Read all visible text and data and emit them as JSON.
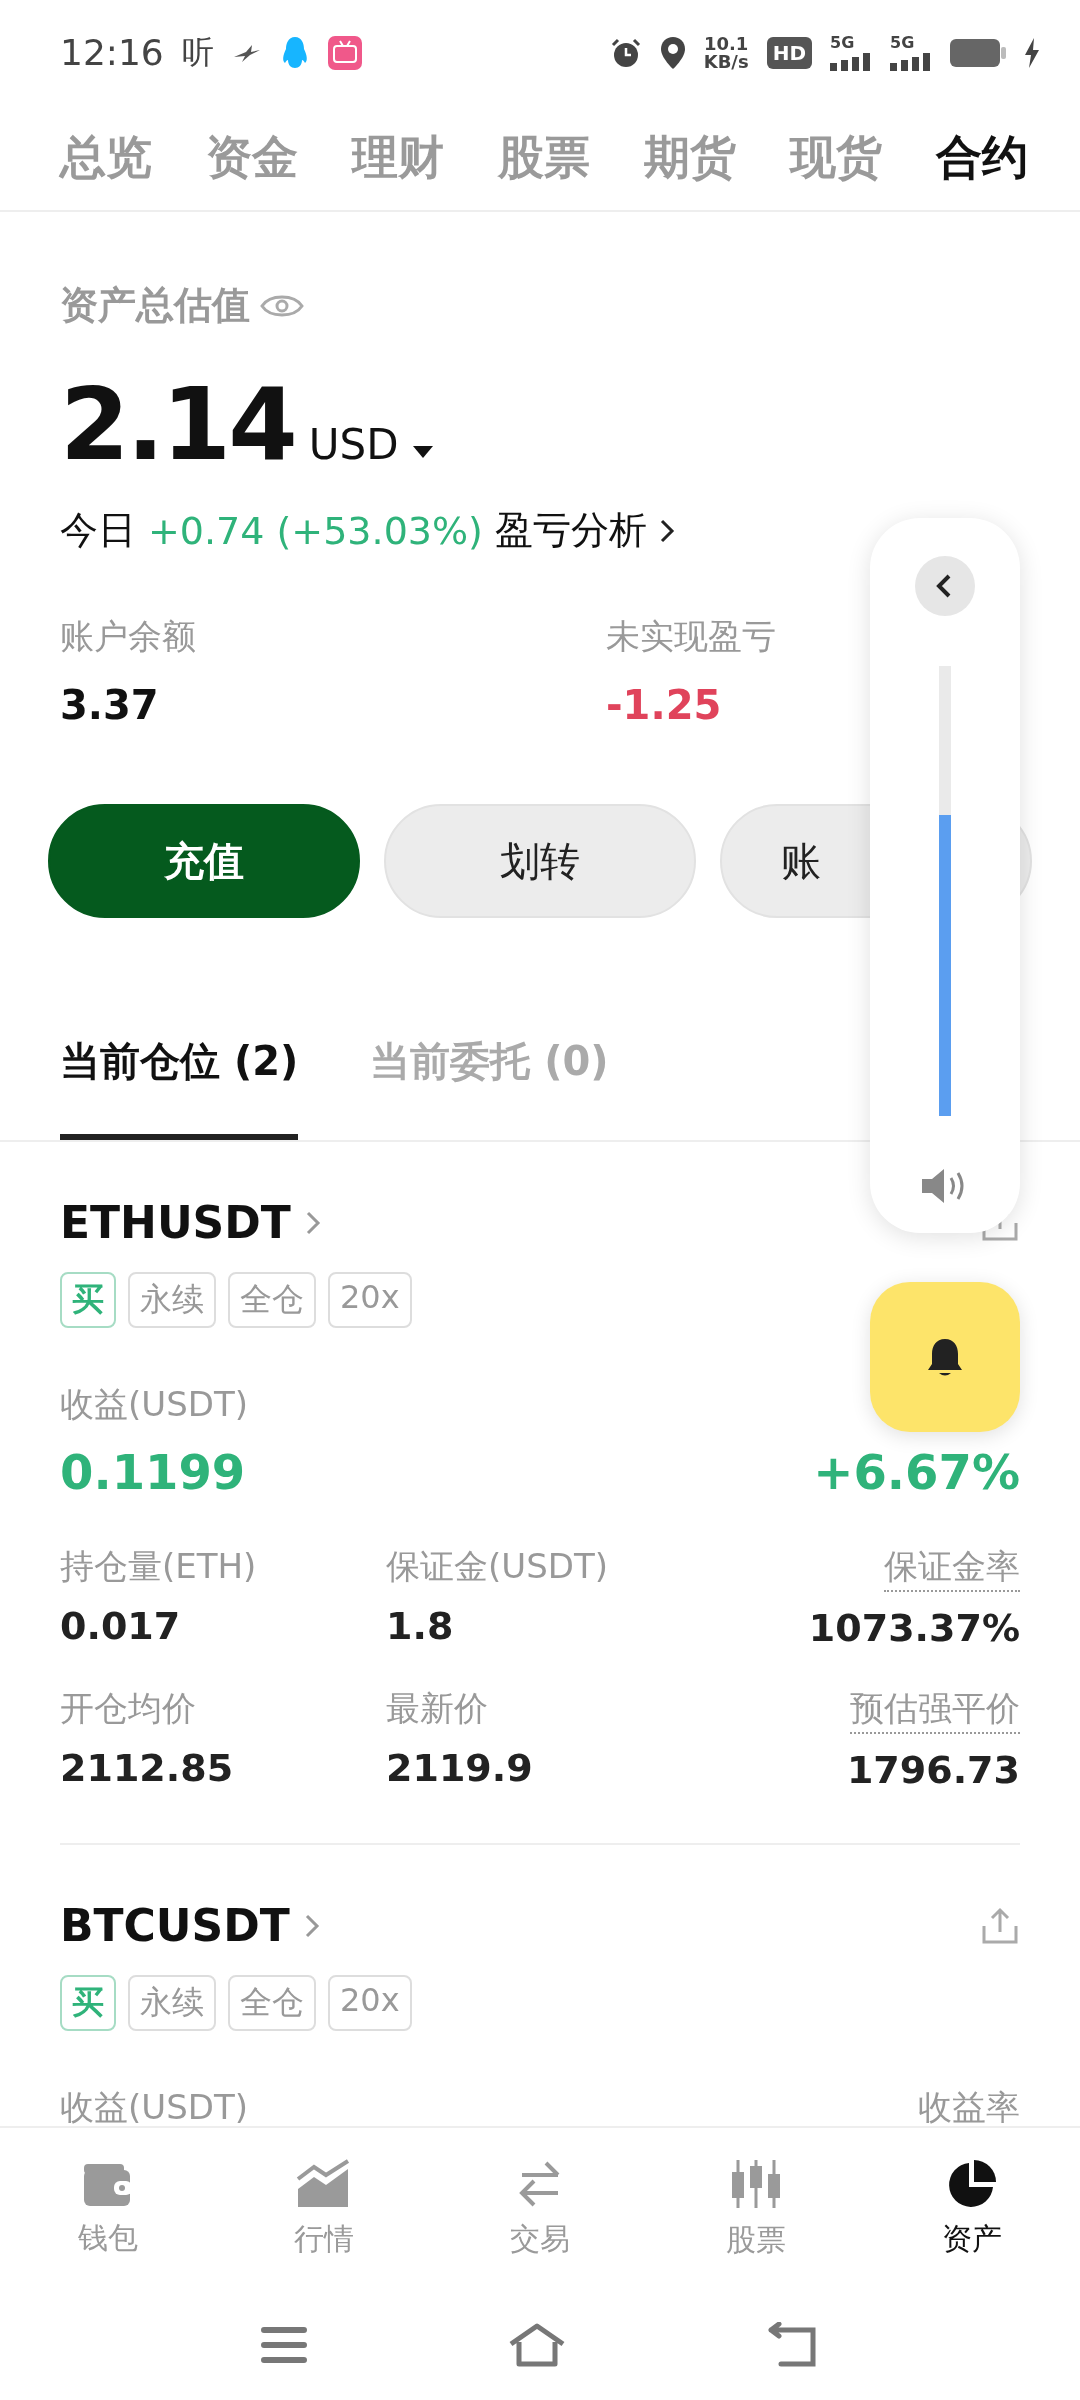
{
  "status_bar": {
    "time": "12:16",
    "app_text": "听",
    "speed_value": "10.1",
    "speed_unit": "KB/s",
    "hd": "HD",
    "sims": [
      {
        "net": "5G"
      },
      {
        "net": "5G"
      }
    ]
  },
  "tabs": [
    {
      "label": "总览",
      "selected": false
    },
    {
      "label": "资金",
      "selected": false
    },
    {
      "label": "理财",
      "selected": false
    },
    {
      "label": "股票",
      "selected": false
    },
    {
      "label": "期货",
      "selected": false
    },
    {
      "label": "现货",
      "selected": false
    },
    {
      "label": "合约",
      "selected": true
    }
  ],
  "summary": {
    "title": "资产总估值",
    "amount": "2.14",
    "currency": "USD",
    "today_label": "今日",
    "today_change": "+0.74 (+53.03%)",
    "analysis_link": "盈亏分析",
    "stats": [
      {
        "label": "账户余额",
        "value": "3.37",
        "loss": false
      },
      {
        "label": "未实现盈亏",
        "value": "-1.25",
        "loss": true
      }
    ]
  },
  "actions": [
    {
      "label": "充值",
      "primary": true
    },
    {
      "label": "划转",
      "primary": false
    },
    {
      "label": "账",
      "primary": false
    }
  ],
  "position_tabs": [
    {
      "label": "当前仓位 (2)",
      "selected": true
    },
    {
      "label": "当前委托 (0)",
      "selected": false
    }
  ],
  "positions": [
    {
      "symbol": "ETHUSDT",
      "tags": [
        {
          "label": "买",
          "kind": "side"
        },
        {
          "label": "永续",
          "kind": "plain"
        },
        {
          "label": "全仓",
          "kind": "plain"
        },
        {
          "label": "20x",
          "kind": "plain"
        }
      ],
      "pnl_label": "收益(USDT)",
      "pnl_value": "0.1199",
      "rate_value": "+6.67%",
      "fields": [
        {
          "label": "持仓量(ETH)",
          "value": "0.017",
          "underlined": false
        },
        {
          "label": "保证金(USDT)",
          "value": "1.8",
          "underlined": false
        },
        {
          "label": "保证金率",
          "value": "1073.37%",
          "underlined": true
        },
        {
          "label": "开仓均价",
          "value": "2112.85",
          "underlined": false
        },
        {
          "label": "最新价",
          "value": "2119.9",
          "underlined": false
        },
        {
          "label": "预估强平价",
          "value": "1796.73",
          "underlined": true
        }
      ]
    },
    {
      "symbol": "BTCUSDT",
      "tags": [
        {
          "label": "买",
          "kind": "side"
        },
        {
          "label": "永续",
          "kind": "plain"
        },
        {
          "label": "全仓",
          "kind": "plain"
        },
        {
          "label": "20x",
          "kind": "plain"
        }
      ],
      "pnl_label": "收益(USDT)",
      "rate_label": "收益率"
    }
  ],
  "bottom_nav": [
    {
      "label": "钱包",
      "kind": "wallet",
      "selected": false
    },
    {
      "label": "行情",
      "kind": "market",
      "selected": false
    },
    {
      "label": "交易",
      "kind": "trade",
      "selected": false
    },
    {
      "label": "股票",
      "kind": "stocks",
      "selected": false
    },
    {
      "label": "资产",
      "kind": "assets",
      "selected": true
    }
  ],
  "volume": {
    "level": 0.67
  }
}
